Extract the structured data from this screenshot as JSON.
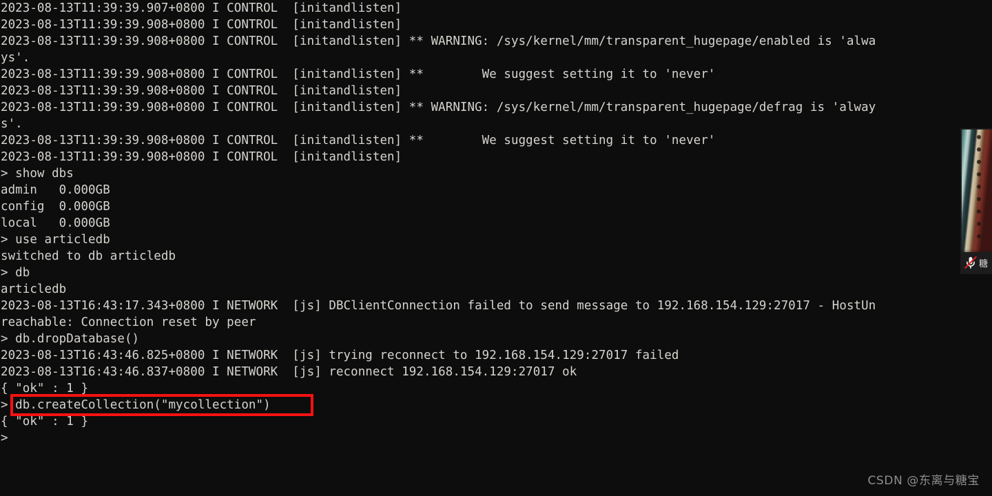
{
  "terminal": {
    "background_color": "#0d0d0d",
    "text_color": "#d6d4cf",
    "lines": [
      "2023-08-13T11:39:39.907+0800 I CONTROL  [initandlisten]",
      "2023-08-13T11:39:39.908+0800 I CONTROL  [initandlisten]",
      "2023-08-13T11:39:39.908+0800 I CONTROL  [initandlisten] ** WARNING: /sys/kernel/mm/transparent_hugepage/enabled is 'alwa",
      "ys'.",
      "2023-08-13T11:39:39.908+0800 I CONTROL  [initandlisten] **        We suggest setting it to 'never'",
      "2023-08-13T11:39:39.908+0800 I CONTROL  [initandlisten]",
      "2023-08-13T11:39:39.908+0800 I CONTROL  [initandlisten] ** WARNING: /sys/kernel/mm/transparent_hugepage/defrag is 'alway",
      "s'.",
      "2023-08-13T11:39:39.908+0800 I CONTROL  [initandlisten] **        We suggest setting it to 'never'",
      "2023-08-13T11:39:39.908+0800 I CONTROL  [initandlisten]",
      "> show dbs",
      "admin   0.000GB",
      "config  0.000GB",
      "local   0.000GB",
      "> use articledb",
      "switched to db articledb",
      "> db",
      "articledb",
      "2023-08-13T16:43:17.343+0800 I NETWORK  [js] DBClientConnection failed to send message to 192.168.154.129:27017 - HostUn",
      "reachable: Connection reset by peer",
      "> db.dropDatabase()",
      "2023-08-13T16:43:46.825+0800 I NETWORK  [js] trying reconnect to 192.168.154.129:27017 failed",
      "2023-08-13T16:43:46.837+0800 I NETWORK  [js] reconnect 192.168.154.129:27017 ok",
      "{ \"ok\" : 1 }",
      "> db.createCollection(\"mycollection\")",
      "{ \"ok\" : 1 }",
      ">"
    ]
  },
  "annotation": {
    "highlight_box_color": "#fb1111",
    "highlighted_command": "db.createCollection(\"mycollection\")"
  },
  "video_thumbnail": {
    "mic_icon": "microphone-muted-icon",
    "mic_slash_color": "#e02020",
    "participant_label": "糖"
  },
  "watermark": {
    "text": "CSDN @东离与糖宝"
  }
}
